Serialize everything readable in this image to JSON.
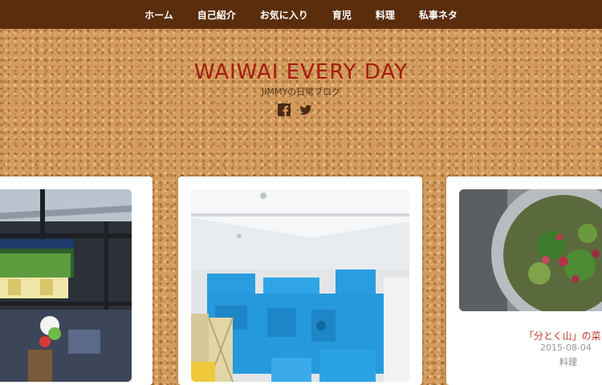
{
  "nav": {
    "items": [
      {
        "label": "ホーム"
      },
      {
        "label": "自己紹介"
      },
      {
        "label": "お気に入り"
      },
      {
        "label": "育児"
      },
      {
        "label": "料理"
      },
      {
        "label": "私事ネタ"
      }
    ]
  },
  "header": {
    "title": "WAIWAI EVERY DAY",
    "tagline": "JIMMYの日常ブログ",
    "social_icons": [
      "facebook-icon",
      "twitter-icon"
    ]
  },
  "posts": [
    {
      "image": "stadium-photo"
    },
    {
      "image": "blue-foam-blocks-photo"
    },
    {
      "image": "greens-in-colander-photo",
      "title": "「分とく山」の菜",
      "date": "2015-08-04",
      "category": "料理"
    }
  ],
  "colors": {
    "nav_bg": "#5a2d0c",
    "title": "#a51c10",
    "post_title": "#c0392b"
  }
}
